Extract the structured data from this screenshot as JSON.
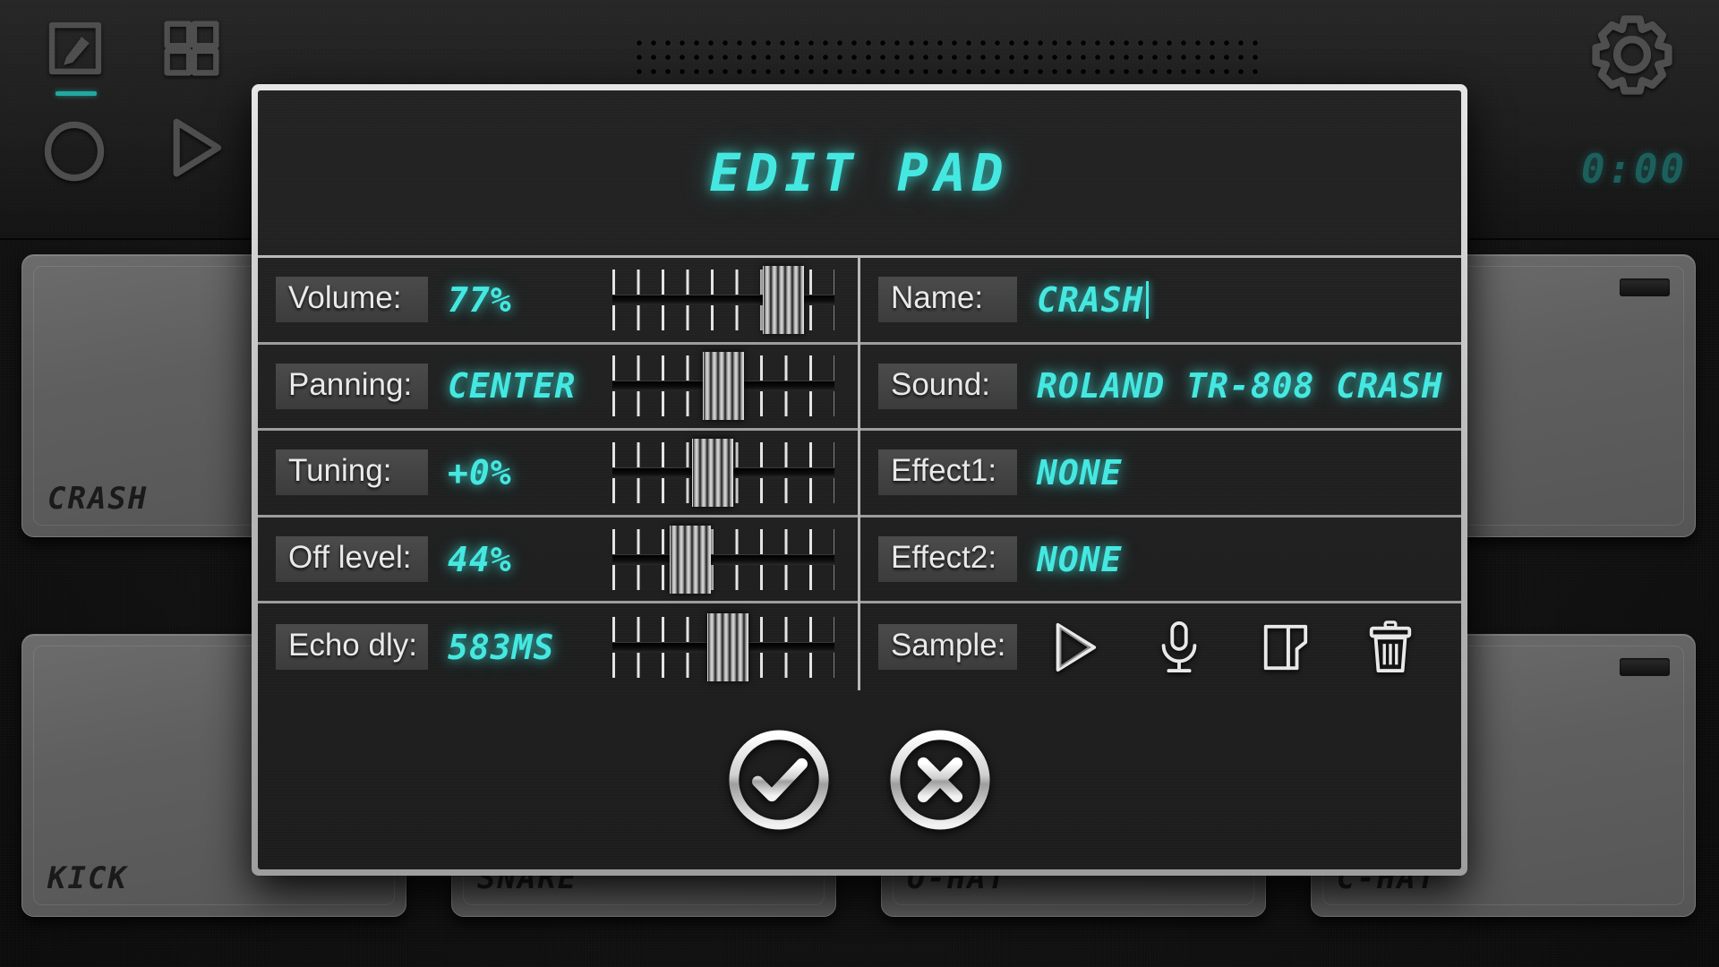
{
  "app": {
    "timer": "0:00",
    "toolbar": [
      {
        "name": "edit-pad-tool",
        "label": "Edit",
        "active": true
      },
      {
        "name": "grid-tool",
        "label": "Pads",
        "active": false
      },
      {
        "name": "record-tool",
        "label": "Record",
        "active": false
      },
      {
        "name": "play-tool",
        "label": "Play",
        "active": false
      }
    ],
    "settings_label": "Settings"
  },
  "pads": [
    {
      "name": "CRASH"
    },
    {
      "name": "KICK"
    },
    {
      "name": "SNARE"
    },
    {
      "name": "O-HAT"
    },
    {
      "name": "C-HAT"
    }
  ],
  "dialog": {
    "title": "EDIT PAD",
    "left_rows": [
      {
        "label": "Volume:",
        "value": "77%",
        "slider_pct": 77
      },
      {
        "label": "Panning:",
        "value": "CENTER",
        "slider_pct": 50
      },
      {
        "label": "Tuning:",
        "value": "+0%",
        "slider_pct": 45
      },
      {
        "label": "Off level:",
        "value": "44%",
        "slider_pct": 35
      },
      {
        "label": "Echo dly:",
        "value": "583MS",
        "slider_pct": 52
      }
    ],
    "right_rows": [
      {
        "label": "Name:",
        "value": "CRASH"
      },
      {
        "label": "Sound:",
        "value": "ROLAND TR-808 CRASH"
      },
      {
        "label": "Effect1:",
        "value": "NONE"
      },
      {
        "label": "Effect2:",
        "value": "NONE"
      },
      {
        "label": "Sample:",
        "value": ""
      }
    ],
    "sample_icons": [
      {
        "name": "play-icon",
        "label": "Play sample"
      },
      {
        "name": "microphone-icon",
        "label": "Record sample"
      },
      {
        "name": "open-file-icon",
        "label": "Load sample"
      },
      {
        "name": "trash-icon",
        "label": "Delete sample"
      }
    ],
    "confirm_label": "OK",
    "cancel_label": "Cancel"
  },
  "colors": {
    "lcd_cyan": "#45e8e0",
    "accent_underline": "#1fa9a0",
    "pad_face": "#5f5f5f",
    "panel_dark": "#1d1d1d"
  }
}
